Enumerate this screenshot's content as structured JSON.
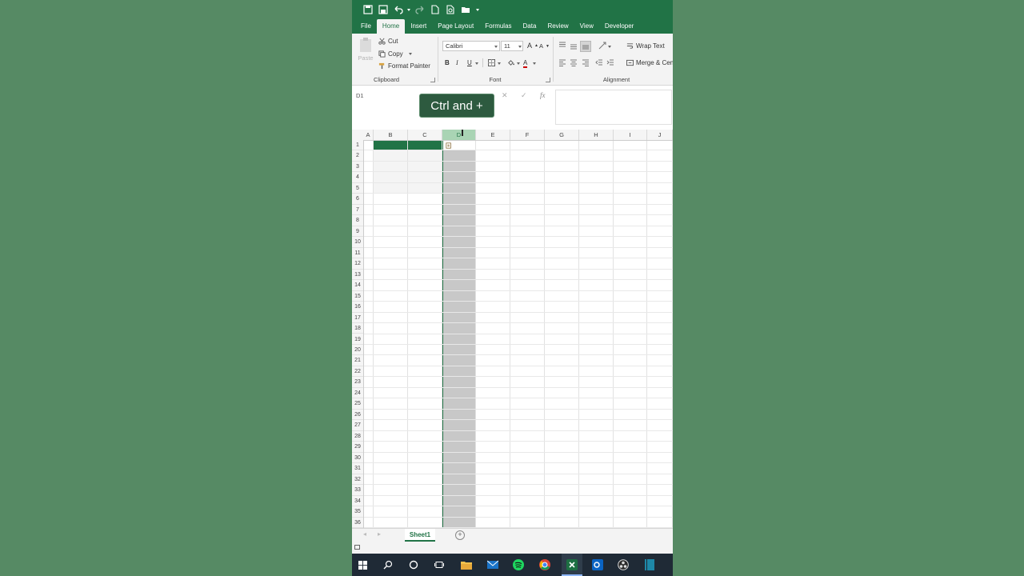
{
  "qat": {
    "icons": [
      "save-icon",
      "save-as-icon",
      "undo-icon",
      "redo-icon",
      "new-file-icon",
      "print-preview-icon",
      "open-folder-icon",
      "customize-icon"
    ]
  },
  "tabs": [
    {
      "label": "File"
    },
    {
      "label": "Home",
      "active": true
    },
    {
      "label": "Insert"
    },
    {
      "label": "Page Layout"
    },
    {
      "label": "Formulas"
    },
    {
      "label": "Data"
    },
    {
      "label": "Review"
    },
    {
      "label": "View"
    },
    {
      "label": "Developer"
    }
  ],
  "ribbon": {
    "clipboard": {
      "paste_label": "Paste",
      "cut_label": "Cut",
      "copy_label": "Copy",
      "format_painter_label": "Format Painter",
      "group_label": "Clipboard"
    },
    "font": {
      "font_name": "Calibri",
      "font_size": "11",
      "bold": "B",
      "italic": "I",
      "underline": "U",
      "group_label": "Font"
    },
    "alignment": {
      "wrap_text_label": "Wrap Text",
      "merge_label": "Merge & Cen",
      "group_label": "Alignment"
    }
  },
  "formula_bar": {
    "name_box": "D1",
    "cancel": "✕",
    "enter": "✓",
    "fx": "fx"
  },
  "tooltip": "Ctrl and +",
  "columns": [
    "A",
    "B",
    "C",
    "D",
    "E",
    "F",
    "G",
    "H",
    "I",
    "J"
  ],
  "selected_column": "D",
  "rows": [
    "1",
    "2",
    "3",
    "4",
    "5",
    "6",
    "7",
    "8",
    "9",
    "10",
    "11",
    "12",
    "13",
    "14",
    "15",
    "16",
    "17",
    "18",
    "19",
    "20",
    "21",
    "22",
    "23",
    "24",
    "25",
    "26",
    "27",
    "28",
    "29",
    "30",
    "31",
    "32",
    "33",
    "34",
    "35",
    "36"
  ],
  "sheet_tabs": [
    {
      "label": "Sheet1",
      "active": true
    }
  ],
  "colors": {
    "accent": "#217346",
    "selection_fill": "#c8c8c8",
    "background": "#568a64",
    "taskbar": "#1f2a36"
  }
}
